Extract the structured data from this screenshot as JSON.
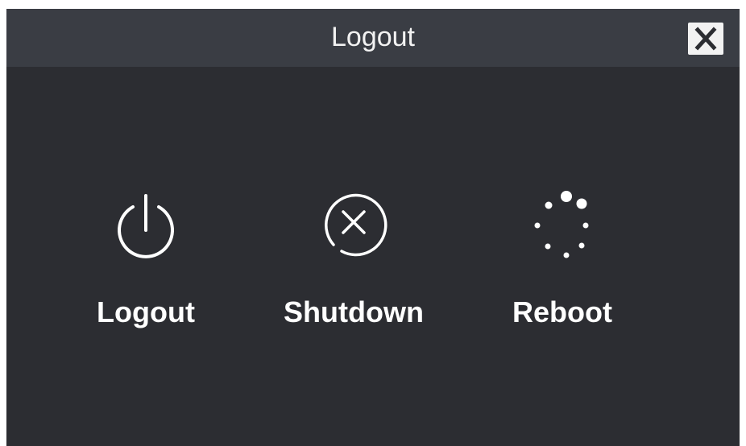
{
  "dialog": {
    "title": "Logout",
    "close_icon": "close-icon"
  },
  "actions": [
    {
      "label": "Logout",
      "icon": "power-icon"
    },
    {
      "label": "Shutdown",
      "icon": "shutdown-icon"
    },
    {
      "label": "Reboot",
      "icon": "reboot-icon"
    }
  ],
  "colors": {
    "titlebar": "#3a3d44",
    "body": "#2c2d32",
    "text": "#ffffff",
    "close_button": "#f2f2f2"
  }
}
